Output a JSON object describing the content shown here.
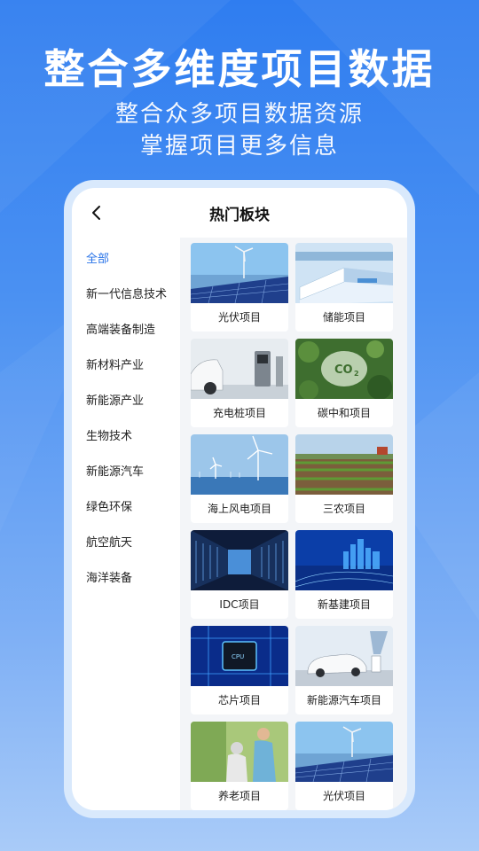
{
  "promo": {
    "headline": "整合多维度项目数据",
    "subline1": "整合众多项目数据资源",
    "subline2": "掌握项目更多信息"
  },
  "header": {
    "title": "热门板块",
    "back_icon": "chevron-left-icon"
  },
  "sidebar": {
    "items": [
      {
        "label": "全部",
        "active": true
      },
      {
        "label": "新一代信息技术"
      },
      {
        "label": "高端装备制造"
      },
      {
        "label": "新材料产业"
      },
      {
        "label": "新能源产业"
      },
      {
        "label": "生物技术"
      },
      {
        "label": "新能源汽车"
      },
      {
        "label": "绿色环保"
      },
      {
        "label": "航空航天"
      },
      {
        "label": "海洋装备"
      }
    ]
  },
  "cards": [
    {
      "label": "光伏项目",
      "image": "solar-wind-image"
    },
    {
      "label": "储能项目",
      "image": "energy-storage-image"
    },
    {
      "label": "充电桩项目",
      "image": "charging-station-image"
    },
    {
      "label": "碳中和项目",
      "image": "co2-forest-image"
    },
    {
      "label": "海上风电项目",
      "image": "offshore-wind-image"
    },
    {
      "label": "三农项目",
      "image": "farmland-image"
    },
    {
      "label": "IDC项目",
      "image": "server-room-image"
    },
    {
      "label": "新基建项目",
      "image": "city-network-image"
    },
    {
      "label": "芯片项目",
      "image": "chip-image"
    },
    {
      "label": "新能源汽车项目",
      "image": "electric-car-image"
    },
    {
      "label": "养老项目",
      "image": "elderly-care-image"
    },
    {
      "label": "光伏项目",
      "image": "solar-wind-image"
    }
  ],
  "colors": {
    "accent": "#2a74e8",
    "background_top": "#2f7df0",
    "background_bottom": "#a9cbf8"
  }
}
